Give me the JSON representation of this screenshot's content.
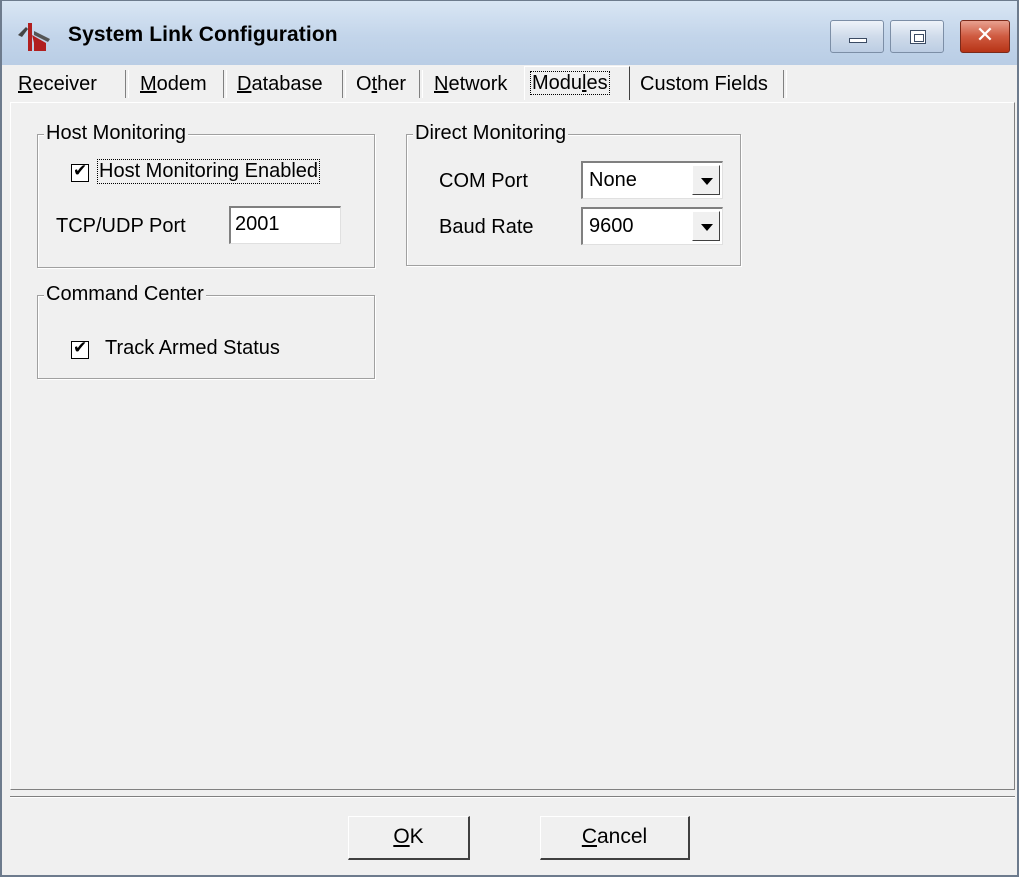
{
  "window": {
    "title": "System Link Configuration",
    "controls": {
      "minimize": "minimize-icon",
      "maximize": "maximize-icon",
      "close": "close-icon"
    },
    "close_glyph": "✕"
  },
  "tabs": [
    {
      "label_pre": "",
      "label_u": "R",
      "label_post": "eceiver"
    },
    {
      "label_pre": "",
      "label_u": "M",
      "label_post": "odem"
    },
    {
      "label_pre": "",
      "label_u": "D",
      "label_post": "atabase"
    },
    {
      "label_pre": "O",
      "label_u": "t",
      "label_post": "her"
    },
    {
      "label_pre": "",
      "label_u": "N",
      "label_post": "etwork"
    },
    {
      "label_pre": "Modu",
      "label_u": "l",
      "label_post": "es"
    },
    {
      "label_pre": "Custom Fields",
      "label_u": "",
      "label_post": ""
    }
  ],
  "active_tab": "Modules",
  "host_monitoring": {
    "title": "Host Monitoring",
    "enabled_label": "Host Monitoring Enabled",
    "enabled": true,
    "port_label": "TCP/UDP Port",
    "port_value": "2001"
  },
  "direct_monitoring": {
    "title": "Direct Monitoring",
    "com_port_label": "COM Port",
    "com_port_value": "None",
    "baud_rate_label": "Baud Rate",
    "baud_rate_value": "9600"
  },
  "command_center": {
    "title": "Command Center",
    "track_label": "Track Armed Status",
    "track_checked": true
  },
  "buttons": {
    "ok_u": "O",
    "ok_rest": "K",
    "cancel_u": "C",
    "cancel_rest": "ancel"
  },
  "colors": {
    "titlebar": "#c3d5ea",
    "dialog_bg": "#f0f0f0",
    "close_button": "#cf5a40"
  }
}
